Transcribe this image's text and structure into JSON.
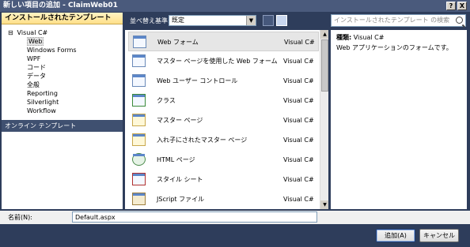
{
  "window": {
    "title": "新しい項目の追加 - ClaimWeb01",
    "help_btn": "?",
    "close_btn": "X"
  },
  "left": {
    "header": "インストールされたテンプレート",
    "root": {
      "toggle": "⊟",
      "label": "Visual C#"
    },
    "children": [
      "Web",
      "Windows Forms",
      "WPF",
      "コード",
      "データ",
      "全般",
      "Reporting",
      "Silverlight",
      "Workflow"
    ],
    "online": "オンライン テンプレート"
  },
  "sort": {
    "label": "並べ替え基準:",
    "value": "既定"
  },
  "search": {
    "placeholder": "インストールされたテンプレート の検索"
  },
  "templates": [
    {
      "name": "Web フォーム",
      "lang": "Visual C#"
    },
    {
      "name": "マスター ページを使用した Web フォーム",
      "lang": "Visual C#"
    },
    {
      "name": "Web ユーザー コントロール",
      "lang": "Visual C#"
    },
    {
      "name": "クラス",
      "lang": "Visual C#"
    },
    {
      "name": "マスター ページ",
      "lang": "Visual C#"
    },
    {
      "name": "入れ子にされたマスター ページ",
      "lang": "Visual C#"
    },
    {
      "name": "HTML ページ",
      "lang": "Visual C#"
    },
    {
      "name": "スタイル シート",
      "lang": "Visual C#"
    },
    {
      "name": "JScript ファイル",
      "lang": "Visual C#"
    }
  ],
  "detail": {
    "type_label": "種類:",
    "type_value": "Visual C#",
    "description": "Web アプリケーションのフォームです。"
  },
  "name_field": {
    "label": "名前(N):",
    "value": "Default.aspx"
  },
  "buttons": {
    "add": "追加(A)",
    "cancel": "キャンセル"
  }
}
